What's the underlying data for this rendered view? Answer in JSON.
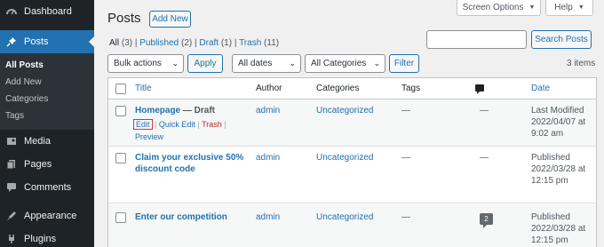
{
  "sidebar": {
    "items": [
      {
        "label": "Dashboard",
        "icon": "dashboard-icon"
      },
      {
        "label": "Posts",
        "icon": "pin-icon"
      },
      {
        "label": "Media",
        "icon": "media-icon"
      },
      {
        "label": "Pages",
        "icon": "pages-icon"
      },
      {
        "label": "Comments",
        "icon": "comments-icon"
      },
      {
        "label": "Appearance",
        "icon": "appearance-icon"
      },
      {
        "label": "Plugins",
        "icon": "plugins-icon"
      }
    ],
    "submenu": [
      "All Posts",
      "Add New",
      "Categories",
      "Tags"
    ]
  },
  "header": {
    "title": "Posts",
    "add_new": "Add New",
    "screen_options": "Screen Options",
    "help": "Help"
  },
  "views": {
    "all": "All",
    "all_count": "(3)",
    "published": "Published",
    "published_count": "(2)",
    "draft": "Draft",
    "draft_count": "(1)",
    "trash": "Trash",
    "trash_count": "(11)"
  },
  "search": {
    "value": "",
    "button": "Search Posts"
  },
  "filters": {
    "bulk": "Bulk actions",
    "apply": "Apply",
    "dates": "All dates",
    "categories": "All Categories",
    "filter": "Filter",
    "items": "3 items"
  },
  "table": {
    "columns": {
      "title": "Title",
      "author": "Author",
      "categories": "Categories",
      "tags": "Tags",
      "date": "Date"
    },
    "rows": [
      {
        "title": "Homepage",
        "state": " — Draft",
        "author": "admin",
        "category": "Uncategorized",
        "tags": "—",
        "comments": "—",
        "date_status": "Last Modified",
        "date": "2022/04/07 at",
        "time": "9:02 am",
        "actions": {
          "edit": "Edit",
          "quick_edit": "Quick Edit",
          "trash": "Trash",
          "preview": "Preview"
        }
      },
      {
        "title_line1": "Claim your exclusive 50%",
        "title_line2": "discount code",
        "author": "admin",
        "category": "Uncategorized",
        "tags": "—",
        "comments": "—",
        "date_status": "Published",
        "date": "2022/03/28 at",
        "time": "12:15 pm"
      },
      {
        "title": "Enter our competition",
        "author": "admin",
        "category": "Uncategorized",
        "tags": "—",
        "comments": "2",
        "date_status": "Published",
        "date": "2022/03/28 at",
        "time": "12:15 pm"
      }
    ]
  },
  "colors": {
    "sidebar_bg": "#1d2327",
    "accent": "#2271b1",
    "highlight_box": "#d63638"
  }
}
